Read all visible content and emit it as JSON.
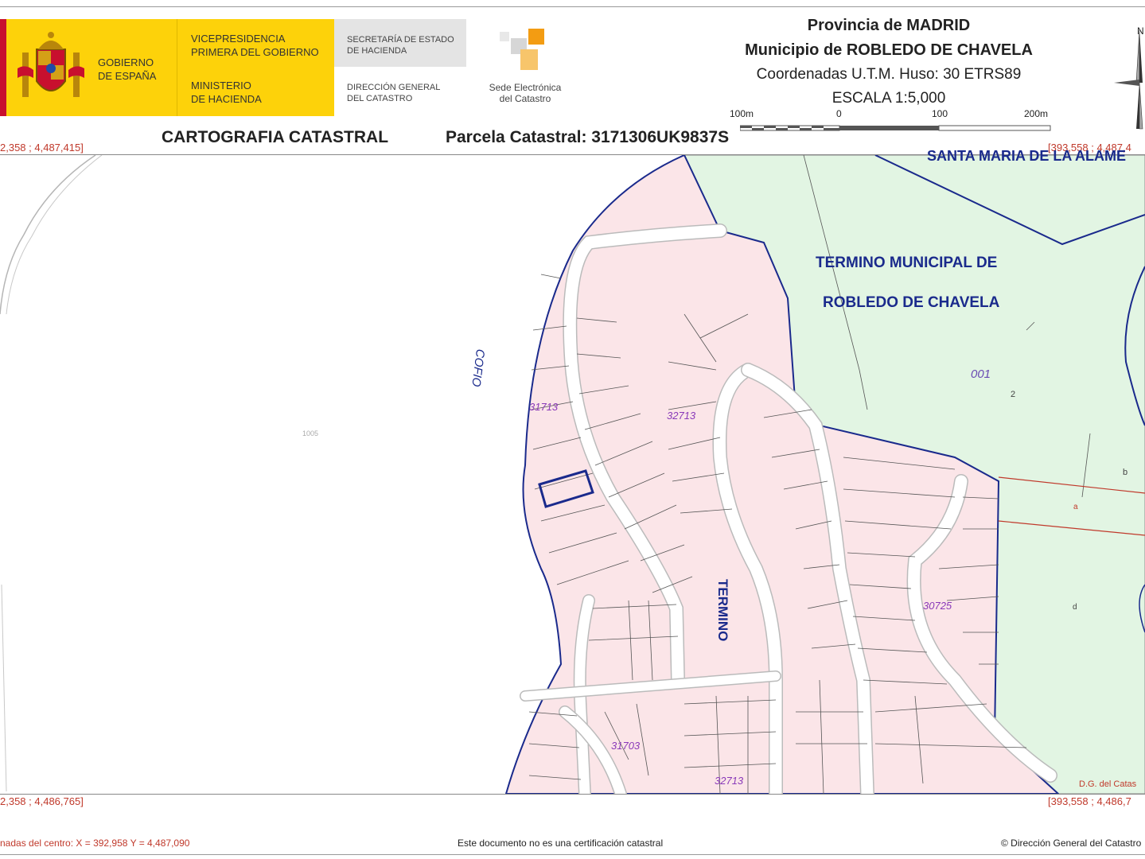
{
  "header": {
    "gobierno": [
      "GOBIERNO",
      "DE ESPAÑA"
    ],
    "vicepresidencia": [
      "VICEPRESIDENCIA",
      "PRIMERA DEL GOBIERNO"
    ],
    "ministerio": [
      "MINISTERIO",
      "DE HACIENDA"
    ],
    "secretaria": [
      "SECRETARÍA DE ESTADO",
      "DE HACIENDA"
    ],
    "direccion": [
      "DIRECCIÓN GENERAL",
      "DEL CATASTRO"
    ],
    "sede": [
      "Sede Electrónica",
      "del Catastro"
    ],
    "provincia": "Provincia de MADRID",
    "municipio": "Municipio de ROBLEDO DE CHAVELA",
    "coordenadas": "Coordenadas U.T.M. Huso: 30 ETRS89",
    "escala": "ESCALA 1:5,000",
    "scale_ticks": [
      "100m",
      "0",
      "100",
      "200m"
    ],
    "cartografia": "CARTOGRAFIA CATASTRAL",
    "parcela": "Parcela Catastral: 3171306UK9837S",
    "north_letter": "N"
  },
  "corners": {
    "top_left": "2,358 ; 4,487,415]",
    "top_right": "[393,558 ; 4,487,4",
    "bottom_left": "2,358 ; 4,486,765]",
    "bottom_right": "[393,558 ; 4,486,7"
  },
  "map_labels": {
    "santa_maria": "SANTA MARIA DE LA ALAME",
    "termino_1": "TERMINO MUNICIPAL DE",
    "termino_2": "ROBLEDO DE CHAVELA",
    "cofio": "COFIO",
    "termino_road": "TERMINO",
    "poly_001": "001",
    "left_parcel": "1005",
    "blocks": [
      "31713",
      "32713",
      "30725",
      "31703",
      "32713"
    ],
    "small_numbers": [
      "2",
      "b",
      "a",
      "d"
    ],
    "credit_map": "D.G. del Catas"
  },
  "footer": {
    "center_coords": "nadas del centro: X = 392,958 Y = 4,487,090",
    "disclaimer": "Este documento no es una certificación catastral",
    "copyright": "© Dirección General del Catastro"
  },
  "colors": {
    "urban_fill": "#fbe5e8",
    "rustic_fill": "#e2f5e3",
    "boundary_blue": "#1a2a8c",
    "coord_red": "#c0392b",
    "gov_yellow": "#fdd20a"
  }
}
